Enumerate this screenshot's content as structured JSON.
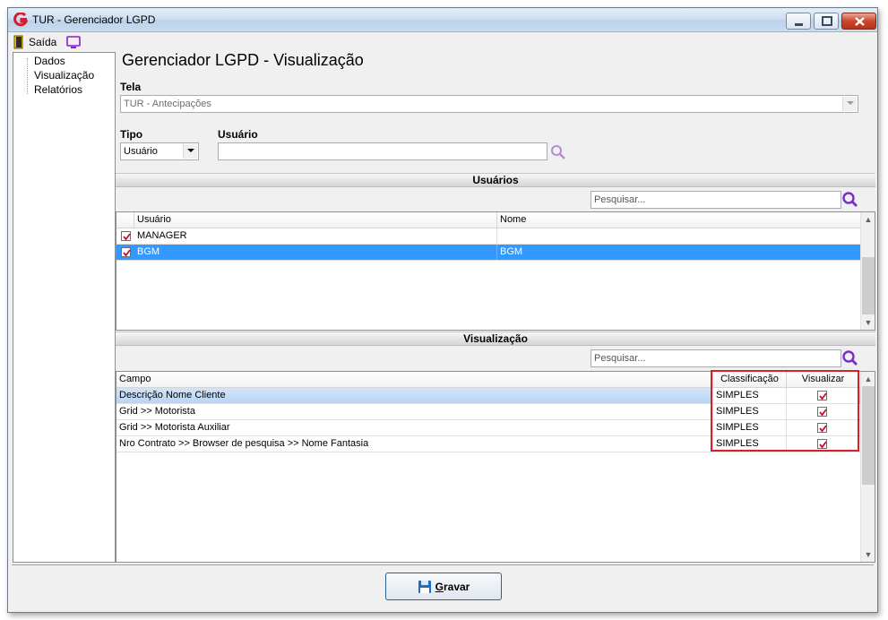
{
  "window": {
    "title": "TUR - Gerenciador LGPD"
  },
  "menubar": {
    "exit_label": "Saída"
  },
  "sidebar": {
    "items": [
      {
        "label": "Dados"
      },
      {
        "label": "Visualização"
      },
      {
        "label": "Relatórios"
      }
    ]
  },
  "main": {
    "title": "Gerenciador LGPD - Visualização",
    "tela": {
      "label": "Tela",
      "value": "TUR - Antecipações"
    },
    "tipo": {
      "label": "Tipo",
      "value": "Usuário"
    },
    "usuario": {
      "label": "Usuário",
      "value": ""
    }
  },
  "users_section": {
    "title": "Usuários",
    "search_placeholder": "Pesquisar...",
    "columns": [
      "Usuário",
      "Nome"
    ],
    "rows": [
      {
        "checked": true,
        "usuario": "MANAGER",
        "nome": ""
      },
      {
        "checked": true,
        "usuario": "BGM",
        "nome": "BGM",
        "selected": true
      }
    ]
  },
  "view_section": {
    "title": "Visualização",
    "search_placeholder": "Pesquisar...",
    "columns": [
      "Campo",
      "Classificação",
      "Visualizar"
    ],
    "rows": [
      {
        "campo": "Descrição Nome Cliente",
        "classificacao": "SIMPLES",
        "visualizar": true
      },
      {
        "campo": "Grid >> Motorista",
        "classificacao": "SIMPLES",
        "visualizar": true
      },
      {
        "campo": "Grid >> Motorista Auxiliar",
        "classificacao": "SIMPLES",
        "visualizar": true
      },
      {
        "campo": "Nro Contrato >> Browser de pesquisa >> Nome Fantasia",
        "classificacao": "SIMPLES",
        "visualizar": true
      }
    ]
  },
  "footer": {
    "save_label_underlined": "G",
    "save_label_rest": "ravar"
  },
  "colors": {
    "selection": "#3399ff",
    "highlight_border": "#d6202a",
    "check": "#c8102e",
    "search_icon": "#7a2ec9"
  }
}
